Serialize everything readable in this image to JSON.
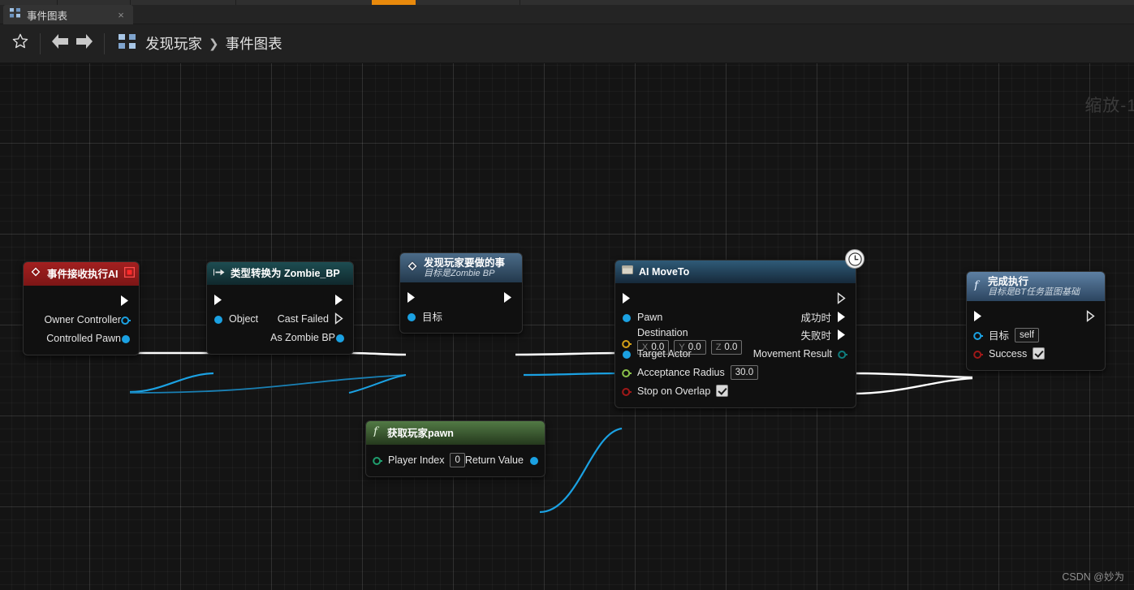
{
  "window": {
    "tab": {
      "label": "事件图表",
      "icon": "graph-icon",
      "close": "×"
    }
  },
  "toolbar": {
    "favorite_icon": "star-icon",
    "back_icon": "arrow-left-icon",
    "forward_icon": "arrow-right-icon",
    "breadcrumb_icon": "graph-icon",
    "breadcrumb": [
      {
        "label": "发现玩家"
      },
      {
        "label": "事件图表"
      }
    ],
    "separator": "❯"
  },
  "overlay": {
    "zoom_label": "缩放-1",
    "watermark": "CSDN @妙为"
  },
  "colors": {
    "exec_white": "#ffffff",
    "object_blue": "#1ba1e2",
    "vector_gold": "#d4a017",
    "float_green": "#8bc24a",
    "bool_red": "#a01818",
    "enum_teal": "#0f7c7c",
    "accent_orange": "#e8890c",
    "event_header": "#a32020",
    "cast_header": "#1d4d52",
    "function_header": "#4b6b88",
    "pure_header": "#527a45",
    "canvas_bg": "#141414"
  },
  "nodes": [
    {
      "id": "event-receive-execute-ai",
      "title": "事件接收执行AI",
      "subtitle": "",
      "header_style": "event",
      "icon": "event-diamond-icon",
      "badge": "delete-node-icon",
      "outputs_exec": [
        {
          "label": ""
        }
      ],
      "outputs_data": [
        {
          "label": "Owner Controller",
          "pin": "object-ring",
          "color": "#1ba1e2"
        },
        {
          "label": "Controlled Pawn",
          "pin": "object-dot",
          "color": "#1ba1e2"
        }
      ]
    },
    {
      "id": "cast-to-zombie-bp",
      "title": "类型转换为 Zombie_BP",
      "subtitle": "",
      "header_style": "cast",
      "icon": "cast-arrow-icon",
      "inputs_exec": [
        {
          "label": ""
        }
      ],
      "outputs_exec": [
        {
          "label": ""
        },
        {
          "label": "Cast Failed"
        }
      ],
      "inputs_data": [
        {
          "label": "Object",
          "pin": "object-dot",
          "color": "#1ba1e2"
        }
      ],
      "outputs_data": [
        {
          "label": "As Zombie BP",
          "pin": "object-dot",
          "color": "#1ba1e2"
        }
      ]
    },
    {
      "id": "found-player-action",
      "title": "发现玩家要做的事",
      "subtitle": "目标是Zombie BP",
      "header_style": "fn",
      "icon": "event-diamond-icon",
      "inputs_exec": [
        {
          "label": ""
        }
      ],
      "outputs_exec": [
        {
          "label": ""
        }
      ],
      "inputs_data": [
        {
          "label": "目标",
          "pin": "object-dot",
          "color": "#1ba1e2"
        }
      ]
    },
    {
      "id": "ai-move-to",
      "title": "AI MoveTo",
      "subtitle": "",
      "header_style": "ai",
      "icon": "task-icon",
      "badge": "clock-icon",
      "inputs_exec": [
        {
          "label": ""
        }
      ],
      "outputs_exec": [
        {
          "label": ""
        },
        {
          "label": "成功时"
        },
        {
          "label": "失败时"
        }
      ],
      "inputs_data": [
        {
          "label": "Pawn",
          "pin": "object-dot",
          "color": "#1ba1e2",
          "value": null
        },
        {
          "label": "Destination",
          "pin": "vector-ring",
          "color": "#d4a017",
          "vector": [
            {
              "axis": "X",
              "value": "0.0"
            },
            {
              "axis": "Y",
              "value": "0.0"
            },
            {
              "axis": "Z",
              "value": "0.0"
            }
          ]
        },
        {
          "label": "Target Actor",
          "pin": "object-dot",
          "color": "#1ba1e2",
          "value": null
        },
        {
          "label": "Acceptance Radius",
          "pin": "float-ring",
          "color": "#8bc24a",
          "value": "30.0"
        },
        {
          "label": "Stop on Overlap",
          "pin": "bool-ring",
          "color": "#a01818",
          "checkbox": true
        }
      ],
      "outputs_data": [
        {
          "label": "Movement Result",
          "pin": "enum-ring",
          "color": "#0f7c7c"
        }
      ]
    },
    {
      "id": "get-player-pawn",
      "title": "获取玩家pawn",
      "subtitle": "",
      "header_style": "pure",
      "icon": "function-f-icon",
      "inputs_data": [
        {
          "label": "Player Index",
          "pin": "int-ring",
          "color": "#1f9e6e",
          "value": "0"
        }
      ],
      "outputs_data": [
        {
          "label": "Return Value",
          "pin": "object-dot",
          "color": "#1ba1e2"
        }
      ]
    },
    {
      "id": "finish-execute",
      "title": "完成执行",
      "subtitle": "目标是BT任务蓝图基础",
      "header_style": "fn2",
      "icon": "function-f-icon",
      "inputs_exec": [
        {
          "label": ""
        }
      ],
      "outputs_exec": [
        {
          "label": ""
        }
      ],
      "inputs_data": [
        {
          "label": "目标",
          "pin": "object-ring",
          "color": "#1ba1e2",
          "value": "self"
        },
        {
          "label": "Success",
          "pin": "bool-ring",
          "color": "#a01818",
          "checkbox": true
        }
      ]
    }
  ]
}
